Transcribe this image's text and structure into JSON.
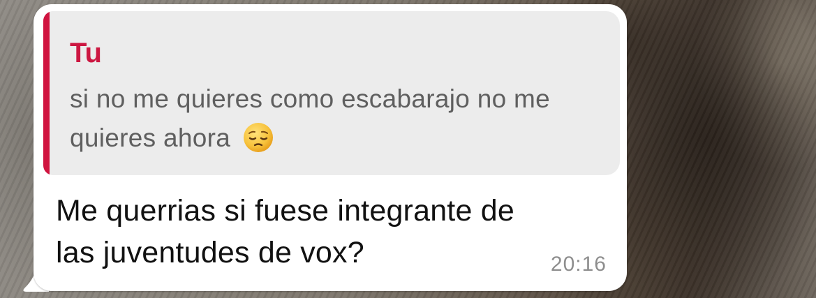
{
  "quoted_message": {
    "author": "Tu",
    "text": "si no me quieres como escabarajo no me quieres ahora",
    "emoji": "pensive-face-icon"
  },
  "message": {
    "text": "Me querrias si fuese integrante de las juventudes de vox?",
    "time": "20:16"
  },
  "colors": {
    "quote_accent": "#d0143f",
    "bubble_background": "#ffffff",
    "quote_background": "#ececec"
  }
}
